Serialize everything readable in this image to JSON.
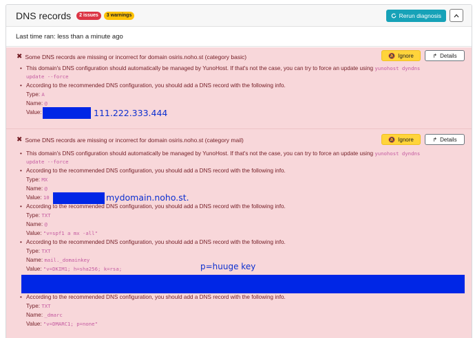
{
  "header": {
    "title": "DNS records",
    "issues_badge": "2 issues",
    "warnings_badge": "3 warnings",
    "rerun_label": "Rerun diagnosis"
  },
  "last_run": "Last time ran: less than a minute ago",
  "reports": [
    {
      "message": "Some DNS records are missing or incorrect for domain osiris.noho.st (category basic)",
      "ignore_label": "Ignore",
      "details_label": "Details",
      "details": {
        "line1": "This domain's DNS configuration should automatically be managed by YunoHost. If that's not the case, you can try to force an update using",
        "cmd1": "yunohost dyndns",
        "cmd2": "update --force",
        "recommend": "According to the recommended DNS configuration, you should add a DNS record with the following info.",
        "type_label": "Type:",
        "type_value": "A",
        "name_label": "Name:",
        "name_value": "@",
        "value_label": "Value:",
        "overlay": "111.222.333.444"
      }
    },
    {
      "message": "Some DNS records are missing or incorrect for domain osiris.noho.st (category mail)",
      "ignore_label": "Ignore",
      "details_label": "Details",
      "details": {
        "line1": "This domain's DNS configuration should automatically be managed by YunoHost. If that's not the case, you can try to force an update using",
        "cmd1": "yunohost dyndns",
        "cmd2": "update --force",
        "records": [
          {
            "recommend": "According to the recommended DNS configuration, you should add a DNS record with the following info.",
            "type_label": "Type:",
            "type_value": "MX",
            "name_label": "Name:",
            "name_value": "@",
            "value_label": "Value:",
            "value_value": "10",
            "overlay": "mydomain.noho.st."
          },
          {
            "recommend": "According to the recommended DNS configuration, you should add a DNS record with the following info.",
            "type_label": "Type:",
            "type_value": "TXT",
            "name_label": "Name:",
            "name_value": "@",
            "value_label": "Value:",
            "value_value": "\"v=spf1 a mx -all\""
          },
          {
            "recommend": "According to the recommended DNS configuration, you should add a DNS record with the following info.",
            "type_label": "Type:",
            "type_value": "TXT",
            "name_label": "Name:",
            "name_value": "mail._domainkey",
            "value_label": "Value:",
            "value_value": "\"v=DKIM1; h=sha256; k=rsa;",
            "overlay": "p=huuge key"
          },
          {
            "recommend": "According to the recommended DNS configuration, you should add a DNS record with the following info.",
            "type_label": "Type:",
            "type_value": "TXT",
            "name_label": "Name:",
            "name_value": "_dmarc",
            "value_label": "Value:",
            "value_value": "\"v=DMARC1; p=none\""
          }
        ]
      }
    }
  ]
}
